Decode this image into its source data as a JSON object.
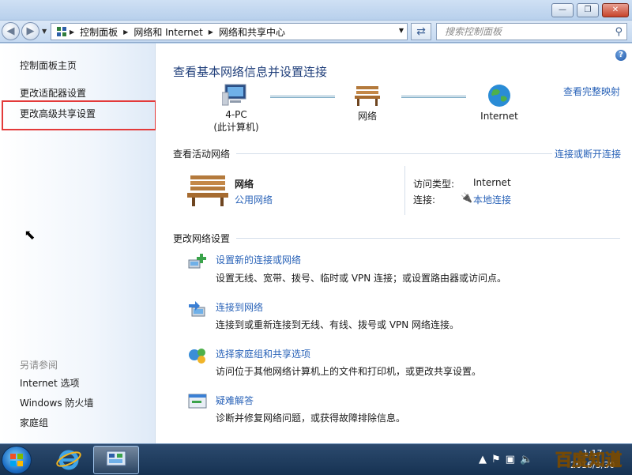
{
  "window": {
    "controls": {
      "minimize": "—",
      "maximize": "❐",
      "close": "✕"
    }
  },
  "address_bar": {
    "back_icon": "back-arrow-icon",
    "forward_icon": "forward-arrow-icon",
    "breadcrumbs": [
      "控制面板",
      "网络和 Internet",
      "网络和共享中心"
    ],
    "search_placeholder": "搜索控制面板"
  },
  "sidebar": {
    "items": [
      "控制面板主页",
      "更改适配器设置",
      "更改高级共享设置"
    ],
    "see_also_heading": "另请参阅",
    "see_also": [
      "Internet 选项",
      "Windows 防火墙",
      "家庭组"
    ],
    "highlighted_item": "更改高级共享设置",
    "highlight_color": "#e33a3a"
  },
  "main": {
    "title": "查看基本网络信息并设置连接",
    "view_full_map": "查看完整映射",
    "map_nodes": [
      {
        "label": "4-PC",
        "sublabel": "(此计算机)",
        "icon": "computer-icon"
      },
      {
        "label": "网络",
        "icon": "bench-network-icon"
      },
      {
        "label": "Internet",
        "icon": "globe-icon"
      }
    ],
    "active_networks_heading": "查看活动网络",
    "connect_disconnect": "连接或断开连接",
    "active_network": {
      "name": "网络",
      "type": "公用网络",
      "access_type_label": "访问类型:",
      "access_type_value": "Internet",
      "connections_label": "连接:",
      "connections_value": "本地连接"
    },
    "change_settings_heading": "更改网络设置",
    "tasks": [
      {
        "title": "设置新的连接或网络",
        "desc": "设置无线、宽带、拨号、临时或 VPN 连接；或设置路由器或访问点。",
        "icon": "new-connection-icon"
      },
      {
        "title": "连接到网络",
        "desc": "连接到或重新连接到无线、有线、拨号或 VPN 网络连接。",
        "icon": "connect-network-icon"
      },
      {
        "title": "选择家庭组和共享选项",
        "desc": "访问位于其他网络计算机上的文件和打印机，或更改共享设置。",
        "icon": "homegroup-icon"
      },
      {
        "title": "疑难解答",
        "desc": "诊断并修复网络问题，或获得故障排除信息。",
        "icon": "troubleshoot-icon"
      }
    ]
  },
  "taskbar": {
    "clock_line1": "1:17",
    "clock_line2": "2016/3/30",
    "watermark": "百度知道"
  }
}
